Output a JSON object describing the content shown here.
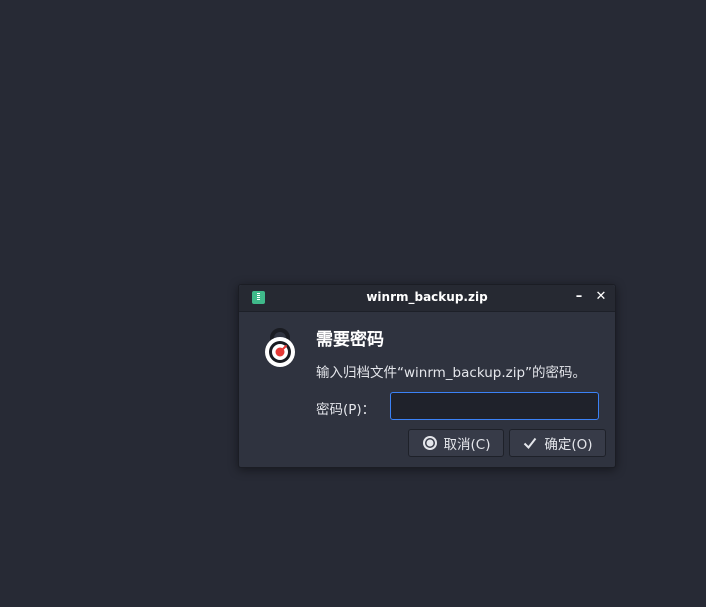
{
  "dialog": {
    "title": "winrm_backup.zip",
    "heading": "需要密码",
    "message": "输入归档文件“winrm_backup.zip”的密码。",
    "password_label": "密码(P)：",
    "password_value": "",
    "cancel_label": "取消(C)",
    "ok_label": "确定(O)",
    "minimize_glyph": "–",
    "close_glyph": "✕"
  },
  "icons": {
    "app": "archive-app-icon",
    "lock": "lock-icon",
    "cancel": "cancel-circle-icon",
    "ok": "checkmark-icon"
  },
  "colors": {
    "background": "#272a35",
    "dialog": "#2f333f",
    "titlebar": "#262932",
    "input_border_focus": "#3b82f6",
    "lock_accent": "#e53935"
  }
}
